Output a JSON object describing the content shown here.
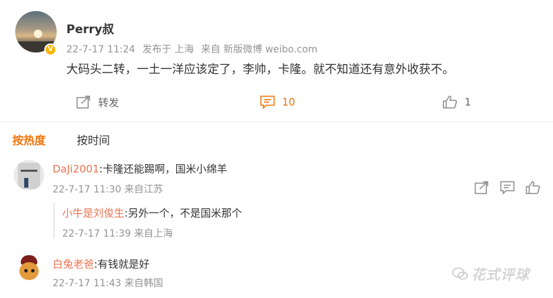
{
  "post": {
    "author": "Perry叔",
    "date": "22-7-17 11:24",
    "published_from": "发布于 上海",
    "source": "来自 新版微博 weibo.com",
    "text": "大码头二转，一土一洋应该定了，李帅，卡隆。就不知道还有意外收获不。",
    "verified_icon": "verified-badge-icon"
  },
  "actions": {
    "repost_label": "转发",
    "comment_count": "10",
    "like_count": "1"
  },
  "sort": {
    "hot": "按热度",
    "time": "按时间"
  },
  "comments": [
    {
      "user": "DaJi2001",
      "text": ":卡隆还能踢啊，国米小绵羊",
      "date": "22-7-17 11:30",
      "location": "来自江苏",
      "replies": [
        {
          "user": "小牛是刘俊生",
          "text": ":另外一个，不是国米那个",
          "date": "22-7-17 11:39",
          "location": "来自上海"
        }
      ]
    },
    {
      "user": "白兔老爸",
      "text": ":有钱就是好",
      "date": "22-7-17 11:43",
      "location": "来自韩国"
    }
  ],
  "watermark": "花式评球",
  "colors": {
    "accent": "#f2730a",
    "username": "#eb7350",
    "meta": "#939393"
  }
}
